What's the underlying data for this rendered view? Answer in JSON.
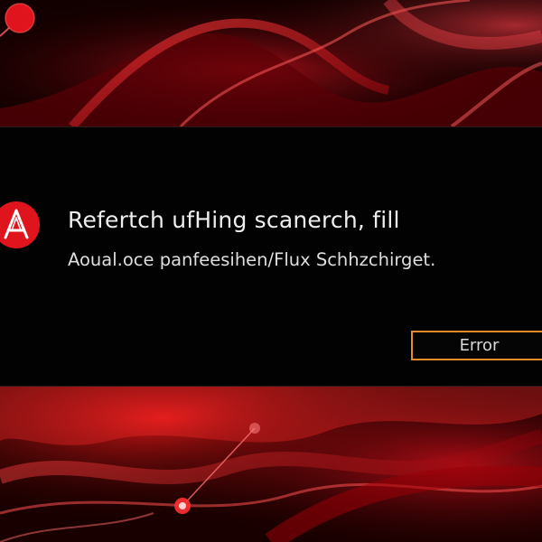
{
  "dialog": {
    "title": "Refertch ufHing scanerch, fill",
    "message": "Aoual.oce panfeesihen/Flux Schhzchirget.",
    "icon": "alert-triangle-icon",
    "button_label": "Error"
  },
  "colors": {
    "accent_red": "#e0141c",
    "button_border": "#e8892a",
    "dialog_background": "#020202"
  }
}
